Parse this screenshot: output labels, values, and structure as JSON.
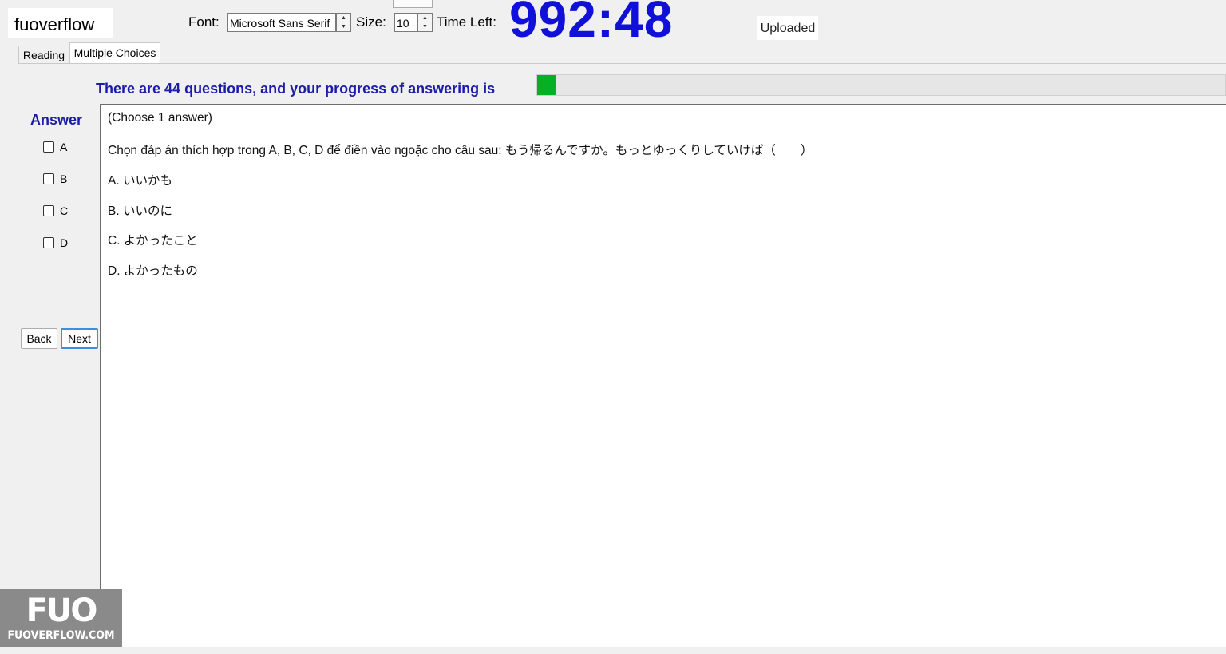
{
  "watermark": {
    "text": "fuoverflow"
  },
  "toolbar": {
    "font_label": "Font:",
    "font_value": "Microsoft Sans Serif",
    "size_label": "Size:",
    "size_value": "10",
    "time_left_label": "Time Left:",
    "timer": "992:48",
    "status": "Uploaded",
    "spin_up": "▲",
    "spin_down": "▼"
  },
  "tabs": [
    {
      "label": "Reading",
      "selected": false
    },
    {
      "label": "Multiple Choices",
      "selected": true
    }
  ],
  "progress": {
    "label": "There are 44 questions, and your progress of answering is",
    "fraction": 0.027,
    "color": "#06b025"
  },
  "answer_panel": {
    "title": "Answer",
    "options": [
      "A",
      "B",
      "C",
      "D"
    ],
    "back_label": "Back",
    "next_label": "Next"
  },
  "question": {
    "instruction": "(Choose 1 answer)",
    "text": "Chọn đáp án thích hợp trong A, B, C, D để điền vào ngoặc cho câu sau:  もう帰るんですか。もっとゆっくりしていけば（　　）",
    "choices": [
      "A. いいかも",
      "B. いいのに",
      "C. よかったこと",
      "D. よかったもの"
    ]
  },
  "logo": {
    "big": "FUO",
    "small": "FUOVERFLOW.COM"
  },
  "colors": {
    "accent_blue": "#1c1ca8",
    "timer_blue": "#1010d8"
  }
}
